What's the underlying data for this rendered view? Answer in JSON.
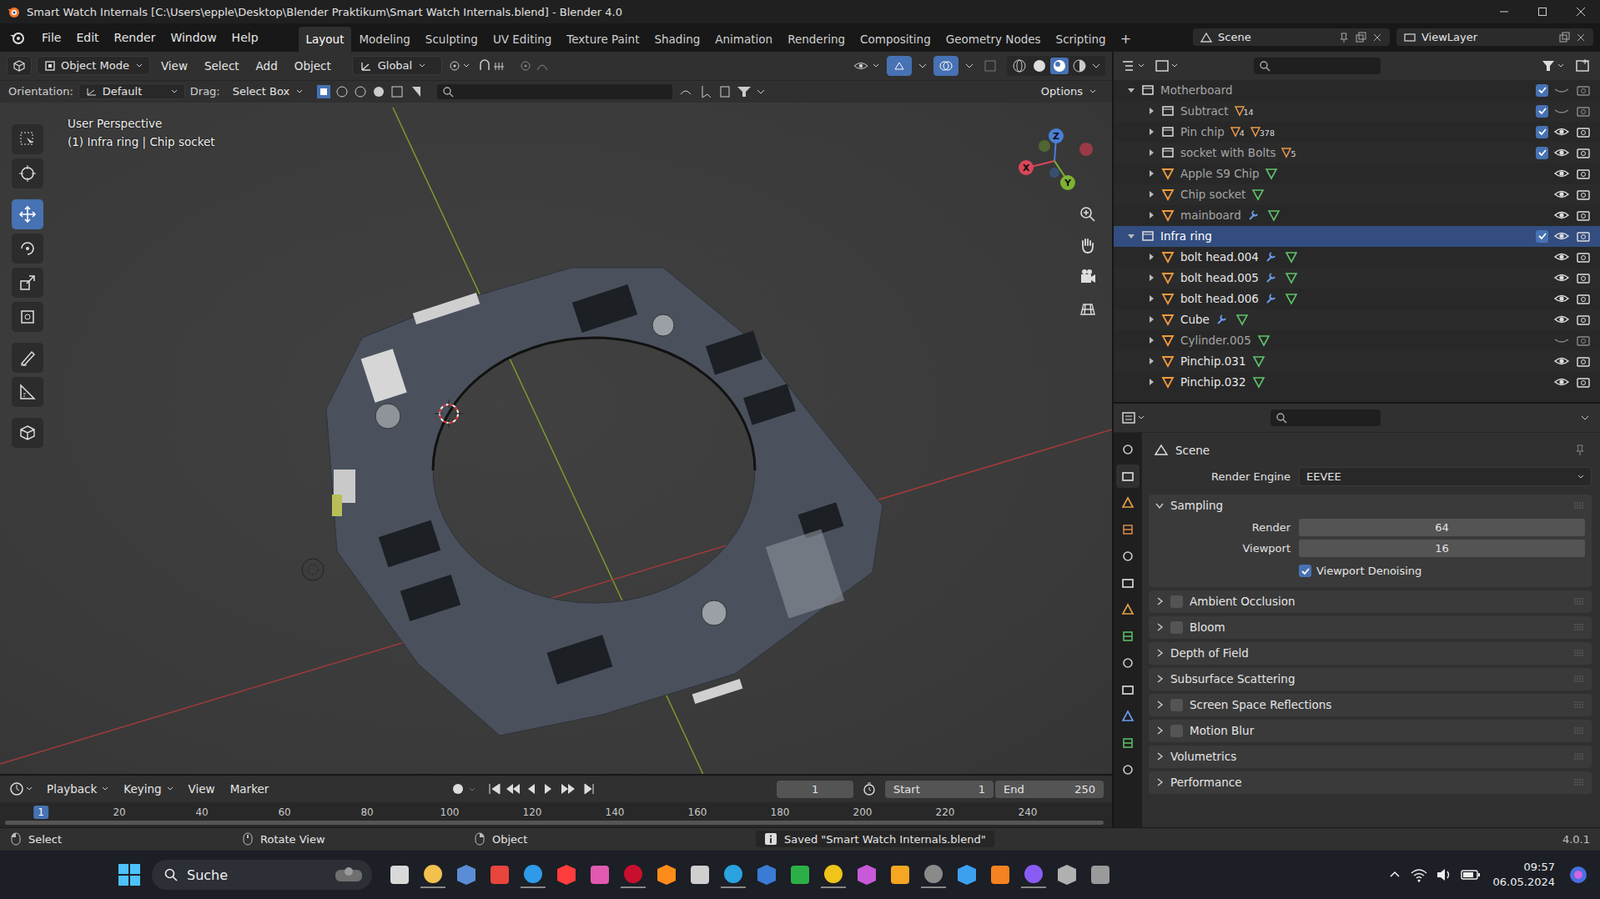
{
  "window": {
    "title": "Smart Watch Internals [C:\\Users\\epple\\Desktop\\Blender Praktikum\\Smart Watch Internals.blend] - Blender 4.0"
  },
  "menu": [
    "File",
    "Edit",
    "Render",
    "Window",
    "Help"
  ],
  "workspaces": [
    {
      "label": "Layout",
      "selected": true
    },
    {
      "label": "Modeling",
      "selected": false
    },
    {
      "label": "Sculpting",
      "selected": false
    },
    {
      "label": "UV Editing",
      "selected": false
    },
    {
      "label": "Texture Paint",
      "selected": false
    },
    {
      "label": "Shading",
      "selected": false
    },
    {
      "label": "Animation",
      "selected": false
    },
    {
      "label": "Rendering",
      "selected": false
    },
    {
      "label": "Compositing",
      "selected": false
    },
    {
      "label": "Geometry Nodes",
      "selected": false
    },
    {
      "label": "Scripting",
      "selected": false
    }
  ],
  "add_workspace": "+",
  "scene": "Scene",
  "view_layer": "ViewLayer",
  "viewport": {
    "mode": "Object Mode",
    "menu": [
      "View",
      "Select",
      "Add",
      "Object"
    ],
    "transform": "Global",
    "orientation_label": "Orientation:",
    "orientation": "Default",
    "drag_label": "Drag:",
    "drag": "Select Box",
    "options": "Options",
    "perspective": "User Perspective",
    "context": "(1) Infra ring | Chip socket",
    "axes": {
      "x": "X",
      "y": "Y",
      "z": "Z"
    },
    "tools": [
      {
        "selected": false
      },
      {
        "selected": false
      },
      {
        "selected": true
      },
      {
        "selected": false
      },
      {
        "selected": false
      },
      {
        "selected": false
      },
      {
        "selected": false
      },
      {
        "selected": false
      },
      {
        "selected": false
      }
    ]
  },
  "outliner": {
    "rows": [
      {
        "name": "Motherboard",
        "kind": "collection",
        "depth": 0,
        "expanded": true,
        "selected": false,
        "dimmed": true,
        "enabled": true,
        "visible": false,
        "has_modifier": false,
        "badges": []
      },
      {
        "name": "Subtract",
        "kind": "collection",
        "depth": 1,
        "expanded": false,
        "selected": false,
        "dimmed": true,
        "enabled": true,
        "visible": false,
        "has_modifier": false,
        "badges": [
          "14"
        ]
      },
      {
        "name": "Pin chip",
        "kind": "collection",
        "depth": 1,
        "expanded": false,
        "selected": false,
        "dimmed": true,
        "enabled": true,
        "visible": true,
        "has_modifier": false,
        "badges": [
          "4",
          "378"
        ]
      },
      {
        "name": "socket with Bolts",
        "kind": "collection",
        "depth": 1,
        "expanded": false,
        "selected": false,
        "dimmed": true,
        "enabled": true,
        "visible": true,
        "has_modifier": false,
        "badges": [
          "5"
        ]
      },
      {
        "name": "Apple S9 Chip",
        "kind": "object",
        "depth": 1,
        "expanded": false,
        "selected": false,
        "dimmed": true,
        "visible": true,
        "has_modifier": false,
        "badges": []
      },
      {
        "name": "Chip socket",
        "kind": "object",
        "depth": 1,
        "expanded": false,
        "selected": false,
        "dimmed": true,
        "visible": true,
        "has_modifier": false,
        "badges": []
      },
      {
        "name": "mainboard",
        "kind": "object",
        "depth": 1,
        "expanded": false,
        "selected": false,
        "dimmed": true,
        "visible": true,
        "has_modifier": true,
        "badges": []
      },
      {
        "name": "Infra ring",
        "kind": "collection",
        "depth": 0,
        "expanded": true,
        "selected": true,
        "dimmed": false,
        "enabled": true,
        "visible": true,
        "has_modifier": false,
        "badges": []
      },
      {
        "name": "bolt head.004",
        "kind": "object",
        "depth": 1,
        "expanded": false,
        "selected": false,
        "dimmed": false,
        "visible": true,
        "has_modifier": true,
        "badges": []
      },
      {
        "name": "bolt head.005",
        "kind": "object",
        "depth": 1,
        "expanded": false,
        "selected": false,
        "dimmed": false,
        "visible": true,
        "has_modifier": true,
        "badges": []
      },
      {
        "name": "bolt head.006",
        "kind": "object",
        "depth": 1,
        "expanded": false,
        "selected": false,
        "dimmed": false,
        "visible": true,
        "has_modifier": true,
        "badges": []
      },
      {
        "name": "Cube",
        "kind": "object",
        "depth": 1,
        "expanded": false,
        "selected": false,
        "dimmed": false,
        "visible": true,
        "has_modifier": true,
        "badges": []
      },
      {
        "name": "Cylinder.005",
        "kind": "object",
        "depth": 1,
        "expanded": false,
        "selected": false,
        "dimmed": true,
        "visible": false,
        "has_modifier": false,
        "badges": []
      },
      {
        "name": "Pinchip.031",
        "kind": "object",
        "depth": 1,
        "expanded": false,
        "selected": false,
        "dimmed": false,
        "visible": true,
        "has_modifier": false,
        "badges": []
      },
      {
        "name": "Pinchip.032",
        "kind": "object",
        "depth": 1,
        "expanded": false,
        "selected": false,
        "dimmed": false,
        "visible": true,
        "has_modifier": false,
        "badges": []
      }
    ]
  },
  "properties": {
    "tabs": [
      {
        "selected": false
      },
      {
        "selected": true
      },
      {
        "selected": false
      },
      {
        "selected": false
      },
      {
        "selected": false
      },
      {
        "selected": false
      },
      {
        "selected": false
      },
      {
        "selected": false
      },
      {
        "selected": false
      },
      {
        "selected": false
      },
      {
        "selected": false
      },
      {
        "selected": false
      },
      {
        "selected": false
      }
    ],
    "title": "Scene",
    "render_engine_label": "Render Engine",
    "render_engine": "EEVEE",
    "sampling": {
      "label": "Sampling",
      "expanded": true,
      "fields": [
        {
          "label": "Render",
          "value": "64"
        },
        {
          "label": "Viewport",
          "value": "16"
        }
      ],
      "denoising": {
        "label": "Viewport Denoising",
        "checked": true
      }
    },
    "panels": [
      {
        "label": "Ambient Occlusion",
        "kind": "toggle",
        "checked": false
      },
      {
        "label": "Bloom",
        "kind": "toggle",
        "checked": false
      },
      {
        "label": "Depth of Field",
        "kind": "plain"
      },
      {
        "label": "Subsurface Scattering",
        "kind": "plain"
      },
      {
        "label": "Screen Space Reflections",
        "kind": "toggle",
        "checked": false
      },
      {
        "label": "Motion Blur",
        "kind": "toggle",
        "checked": false
      },
      {
        "label": "Volumetrics",
        "kind": "plain"
      },
      {
        "label": "Performance",
        "kind": "plain"
      }
    ]
  },
  "timeline": {
    "menu": [
      "Playback",
      "Keying",
      "View",
      "Marker"
    ],
    "frame": "1",
    "start_label": "Start",
    "start": "1",
    "end_label": "End",
    "end": "250",
    "ticks": [
      "1",
      "20",
      "40",
      "60",
      "80",
      "100",
      "120",
      "140",
      "160",
      "180",
      "200",
      "220",
      "240"
    ]
  },
  "status": {
    "items": [
      "Select",
      "Rotate View",
      "Object"
    ],
    "message": "Saved \"Smart Watch Internals.blend\"",
    "version": "4.0.1"
  },
  "taskbar": {
    "search": "Suche",
    "time": "09:57",
    "date": "06.05.2024"
  }
}
